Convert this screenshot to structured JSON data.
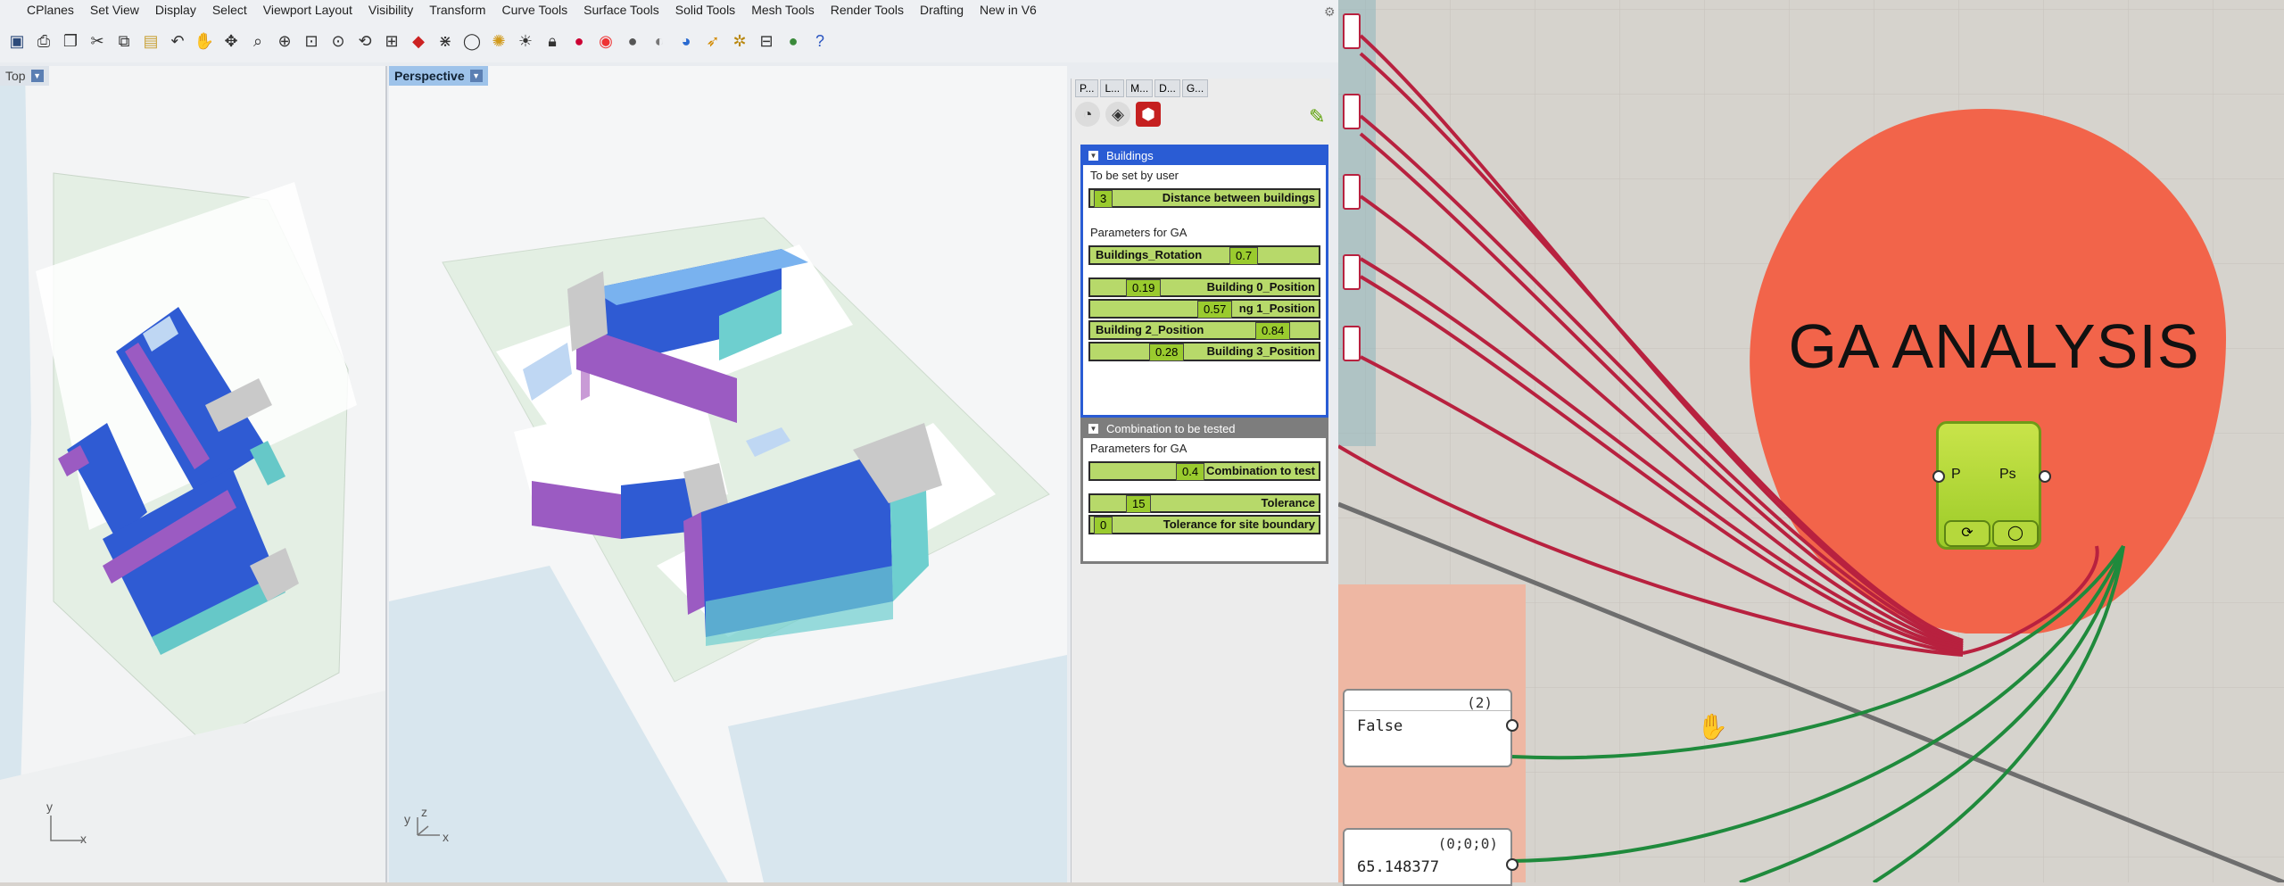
{
  "menubar": {
    "items": [
      "CPlanes",
      "Set View",
      "Display",
      "Select",
      "Viewport Layout",
      "Visibility",
      "Transform",
      "Curve Tools",
      "Surface Tools",
      "Solid Tools",
      "Mesh Tools",
      "Render Tools",
      "Drafting",
      "New in V6"
    ]
  },
  "toolbar": {
    "icons": [
      "save-icon",
      "print-icon",
      "copy-icon",
      "cut-icon",
      "copy-clipboard-icon",
      "paste-icon",
      "undo-icon",
      "pan-icon",
      "rotate-icon",
      "zoom-icon",
      "zoom-window-icon",
      "zoom-extents-icon",
      "zoom-selected-icon",
      "rotate-view-icon",
      "four-viewports-icon",
      "car-icon",
      "snap-icon",
      "ellipse-icon",
      "sparkle-icon",
      "light-icon",
      "lock-icon",
      "render-icon",
      "color-wheel-icon",
      "sphere-icon",
      "material-icon",
      "globe-icon",
      "arrow-icon",
      "object-icon",
      "grid-icon",
      "help-icon"
    ]
  },
  "viewports": {
    "top": {
      "name": "Top",
      "axis_y": "y",
      "axis_x": "x"
    },
    "perspective": {
      "name": "Perspective",
      "axis_y": "y",
      "axis_z": "z",
      "axis_x": "x"
    }
  },
  "gh_panel": {
    "tabs": [
      "P...",
      "L...",
      "M...",
      "D...",
      "G..."
    ],
    "buildings_group": {
      "title": "Buildings",
      "user_label": "To be set by user",
      "distance": {
        "value": "3",
        "label": "Distance between buildings"
      },
      "ga_label": "Parameters for GA",
      "rotation": {
        "label": "Buildings_Rotation",
        "value": "0.7"
      },
      "positions": [
        {
          "value": "0.19",
          "label": "Building 0_Position"
        },
        {
          "value": "0.57",
          "label": "ng 1_Position"
        },
        {
          "value": "0.84",
          "label": "Building 2_Position"
        },
        {
          "value": "0.28",
          "label": "Building 3_Position"
        }
      ]
    },
    "combination_group": {
      "title": "Combination to be tested",
      "ga_label": "Parameters for GA",
      "combination": {
        "value": "0.4",
        "label": "Combination to test"
      },
      "tolerance": {
        "value": "15",
        "label": "Tolerance"
      },
      "site_tolerance": {
        "value": "0",
        "label": "Tolerance for site boundary"
      }
    }
  },
  "gh_canvas": {
    "title": "GA ANALYSIS",
    "component": {
      "input": "P",
      "output": "Ps"
    },
    "boolean_panel": {
      "count": "(2)",
      "value": "False"
    },
    "point_panel": {
      "count": "(0;0;0)",
      "value": "65.148377"
    }
  },
  "colors": {
    "blob": "#f2644a",
    "wire_red": "#b8213f",
    "wire_green": "#1f8a3c",
    "group_blue": "#2a5cd4",
    "group_gray": "#7d7d7d",
    "slider_green": "#b7d96a"
  }
}
